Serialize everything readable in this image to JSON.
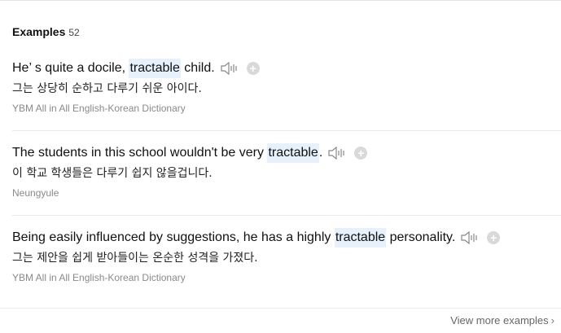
{
  "section": {
    "title": "Examples",
    "count": "52"
  },
  "examples": [
    {
      "en_before": "He’ s quite a docile, ",
      "en_highlight": "tractable",
      "en_after": " child.",
      "ko": "그는 상당히 순하고 다루기 쉬운 아이다.",
      "source": "YBM All in All English-Korean Dictionary"
    },
    {
      "en_before": "The students in this school wouldn't be very ",
      "en_highlight": "tractable",
      "en_after": ".",
      "ko": "이 학교 학생들은 다루기 쉽지 않을겁니다.",
      "source": "Neungyule"
    },
    {
      "en_before": "Being easily influenced by suggestions, he has a highly ",
      "en_highlight": "tractable",
      "en_after": " personality.",
      "ko": "그는 제안을 쉽게 받아들이는 온순한 성격을 가졌다.",
      "source": "YBM All in All English-Korean Dictionary"
    }
  ],
  "footer": {
    "more_label": "View more examples",
    "chevron": "›"
  },
  "icons": {
    "speaker": "speaker-icon",
    "add": "add-icon"
  },
  "colors": {
    "highlight": "#e6f1fb",
    "add_button": "#d9d9d9",
    "source_text": "#8a8a8a"
  }
}
